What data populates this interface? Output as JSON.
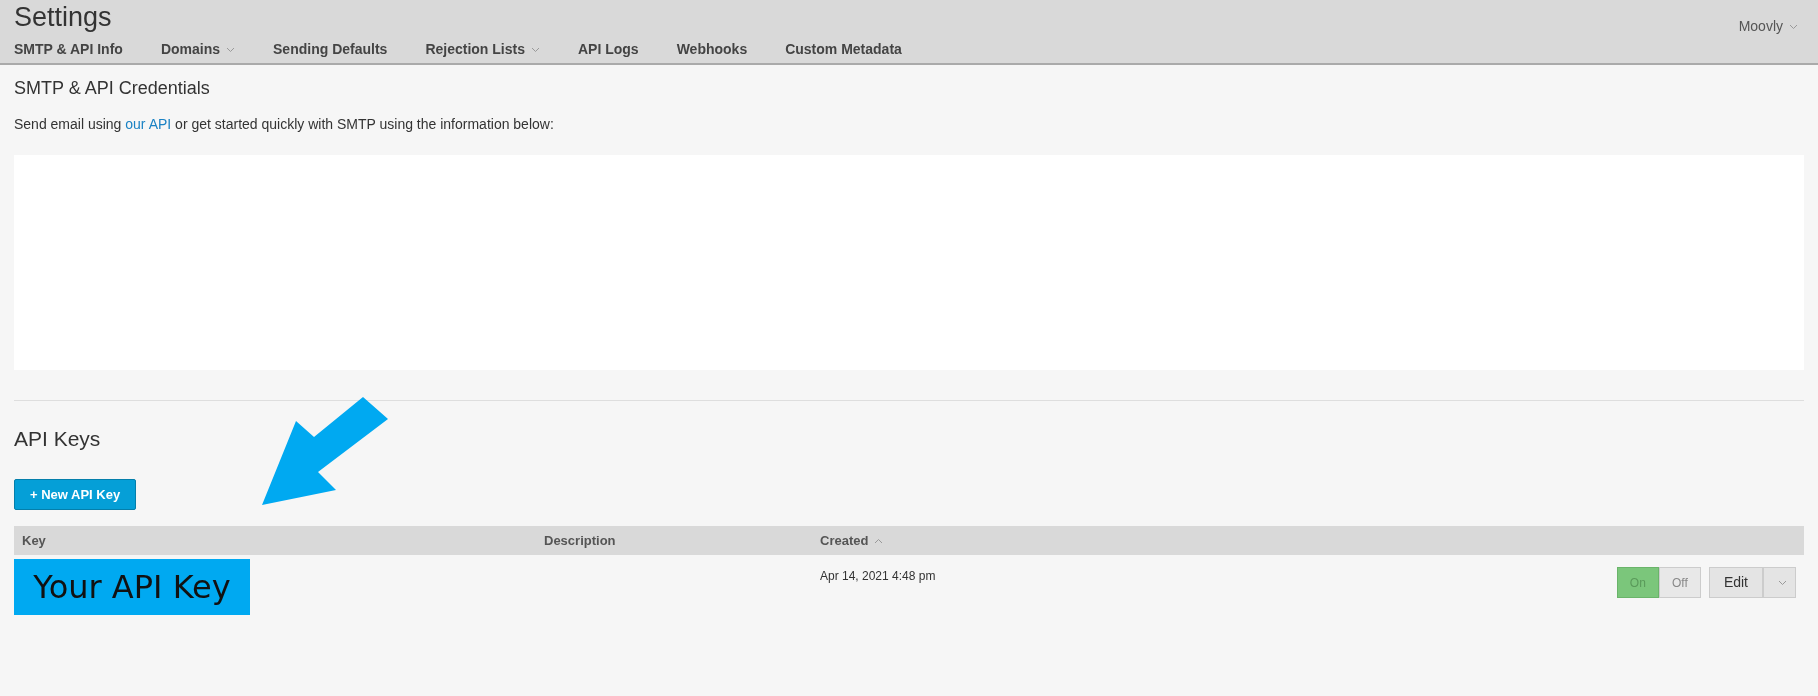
{
  "header": {
    "title": "Settings",
    "account": "Moovly",
    "tabs": [
      {
        "label": "SMTP & API Info",
        "dropdown": false
      },
      {
        "label": "Domains",
        "dropdown": true
      },
      {
        "label": "Sending Defaults",
        "dropdown": false
      },
      {
        "label": "Rejection Lists",
        "dropdown": true
      },
      {
        "label": "API Logs",
        "dropdown": false
      },
      {
        "label": "Webhooks",
        "dropdown": false
      },
      {
        "label": "Custom Metadata",
        "dropdown": false
      }
    ]
  },
  "credentials": {
    "heading": "SMTP & API Credentials",
    "intro_before": "Send email using",
    "intro_link": "our API",
    "intro_after": "or get started quickly with SMTP using the information below:"
  },
  "api_keys": {
    "heading": "API Keys",
    "new_button": "+ New API Key",
    "columns": [
      {
        "label": "Key",
        "sorted": false
      },
      {
        "label": "Description",
        "sorted": false
      },
      {
        "label": "Created",
        "sorted": true
      }
    ],
    "rows": [
      {
        "key": "Your API Key",
        "created": "Apr 14, 2021 4:48 pm",
        "on_label": "On",
        "off_label": "Off",
        "on": true,
        "edit": "Edit"
      }
    ]
  }
}
